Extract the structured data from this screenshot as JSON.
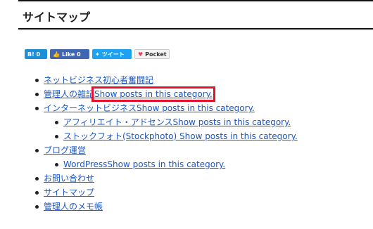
{
  "page": {
    "title": "サイトマップ"
  },
  "share": {
    "hatena": "B! 0",
    "like": "Like 0",
    "tweet": "ツイート",
    "pocket": "Pocket"
  },
  "tree": {
    "item1": "ネットビジネス初心者奮闘記",
    "item2_label": "管理人の雑記",
    "item2_link": "Show posts in this category.",
    "item3": "インターネットビジネスShow posts in this category.",
    "item3_sub1": "アフィリエイト・アドセンスShow posts in this category.",
    "item3_sub2": "ストックフォト(Stockphoto) Show posts in this category.",
    "item4": "ブログ運営",
    "item4_sub1": "WordPressShow posts in this category.",
    "item5": "お問い合わせ",
    "item6": "サイトマップ",
    "item7": "管理人のメモ帳"
  },
  "colors": {
    "link": "#1a56c7",
    "highlight": "#e8112d"
  }
}
